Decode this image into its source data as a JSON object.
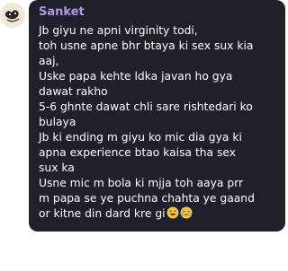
{
  "chat": {
    "sender_name": "Sanket",
    "sender_color": "#b594ea",
    "bubble_color": "#211f2a",
    "message_lines": [
      "Jb giyu ne apni virginity todi,",
      "toh usne apne bhr btaya ki sex sux kia",
      "aaj,",
      "Uske papa kehte ldka javan ho gya",
      "dawat rakho",
      "5-6 ghnte dawat chli sare rishtedari ko",
      "bulaya",
      "Jb ki ending m giyu ko mic dia gya ki",
      "apna experience btao kaisa tha sex",
      "sux ka",
      "Usne mic m bola ki mjja toh aaya prr",
      "m papa se ye puchna chahta ye gaand",
      "or kitne din dard kre gi"
    ],
    "trailing_emojis": [
      "sweat-smile-emoji",
      "crying-emoji"
    ]
  },
  "avatar": {
    "icon": "profile-avatar-icon"
  }
}
